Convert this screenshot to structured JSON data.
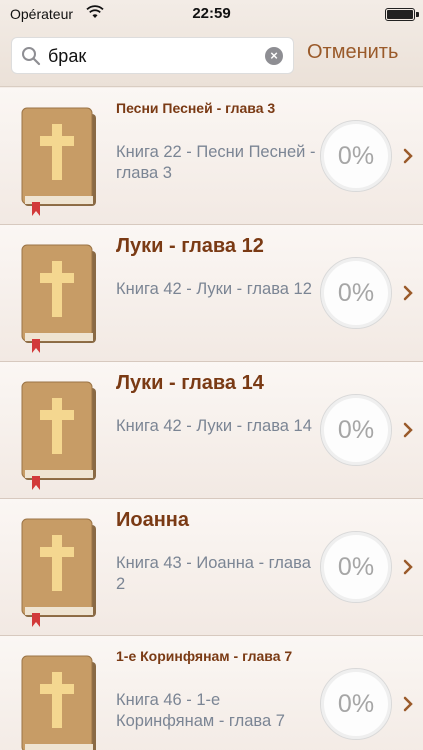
{
  "status_bar": {
    "carrier": "Opérateur",
    "time": "22:59"
  },
  "search": {
    "value": "брак",
    "cancel_label": "Отменить"
  },
  "results": [
    {
      "title": "Песни Песней - глава 3",
      "subtitle": "Книга 22 - Песни Песней - глава 3",
      "progress": "0%",
      "progress_value": 0
    },
    {
      "title": "Луки  - глава 12",
      "subtitle": "Книга 42 - Луки  - глава 12",
      "progress": "0%",
      "progress_value": 0
    },
    {
      "title": "Луки  - глава 14",
      "subtitle": "Книга 42 - Луки  - глава 14",
      "progress": "0%",
      "progress_value": 0
    },
    {
      "title": "Иоанна",
      "subtitle": "Книга 43 - Иоанна  - глава 2",
      "progress": "0%",
      "progress_value": 0
    },
    {
      "title": "1-е Коринфянам - глава 7",
      "subtitle": "Книга 46 - 1-е Коринфянам - глава 7",
      "progress": "0%",
      "progress_value": 0
    }
  ],
  "colors": {
    "accent": "#9a5a2a",
    "title": "#7a3a14",
    "subtitle": "#7b8594",
    "book_cover": "#b98a55",
    "bookmark": "#d23a3a"
  },
  "icons": {
    "search": "search-icon",
    "clear": "clear-icon",
    "book": "bible-book-icon",
    "chevron": "chevron-right-icon",
    "wifi": "wifi-icon",
    "battery": "battery-icon"
  }
}
